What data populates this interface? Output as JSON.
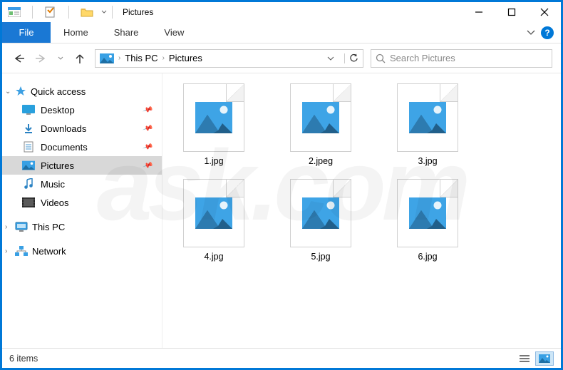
{
  "title": "Pictures",
  "ribbon": {
    "file": "File",
    "tabs": [
      "Home",
      "Share",
      "View"
    ]
  },
  "breadcrumb": [
    "This PC",
    "Pictures"
  ],
  "search_placeholder": "Search Pictures",
  "nav": {
    "quick_access": "Quick access",
    "items": [
      {
        "label": "Desktop",
        "icon": "desktop",
        "pinned": true
      },
      {
        "label": "Downloads",
        "icon": "downloads",
        "pinned": true
      },
      {
        "label": "Documents",
        "icon": "documents",
        "pinned": true
      },
      {
        "label": "Pictures",
        "icon": "pictures",
        "pinned": true,
        "selected": true
      },
      {
        "label": "Music",
        "icon": "music",
        "pinned": false
      },
      {
        "label": "Videos",
        "icon": "videos",
        "pinned": false
      }
    ],
    "this_pc": "This PC",
    "network": "Network"
  },
  "files": [
    {
      "name": "1.jpg"
    },
    {
      "name": "2.jpeg"
    },
    {
      "name": "3.jpg"
    },
    {
      "name": "4.jpg"
    },
    {
      "name": "5.jpg"
    },
    {
      "name": "6.jpg"
    }
  ],
  "status": "6 items",
  "watermark": "ask.com"
}
